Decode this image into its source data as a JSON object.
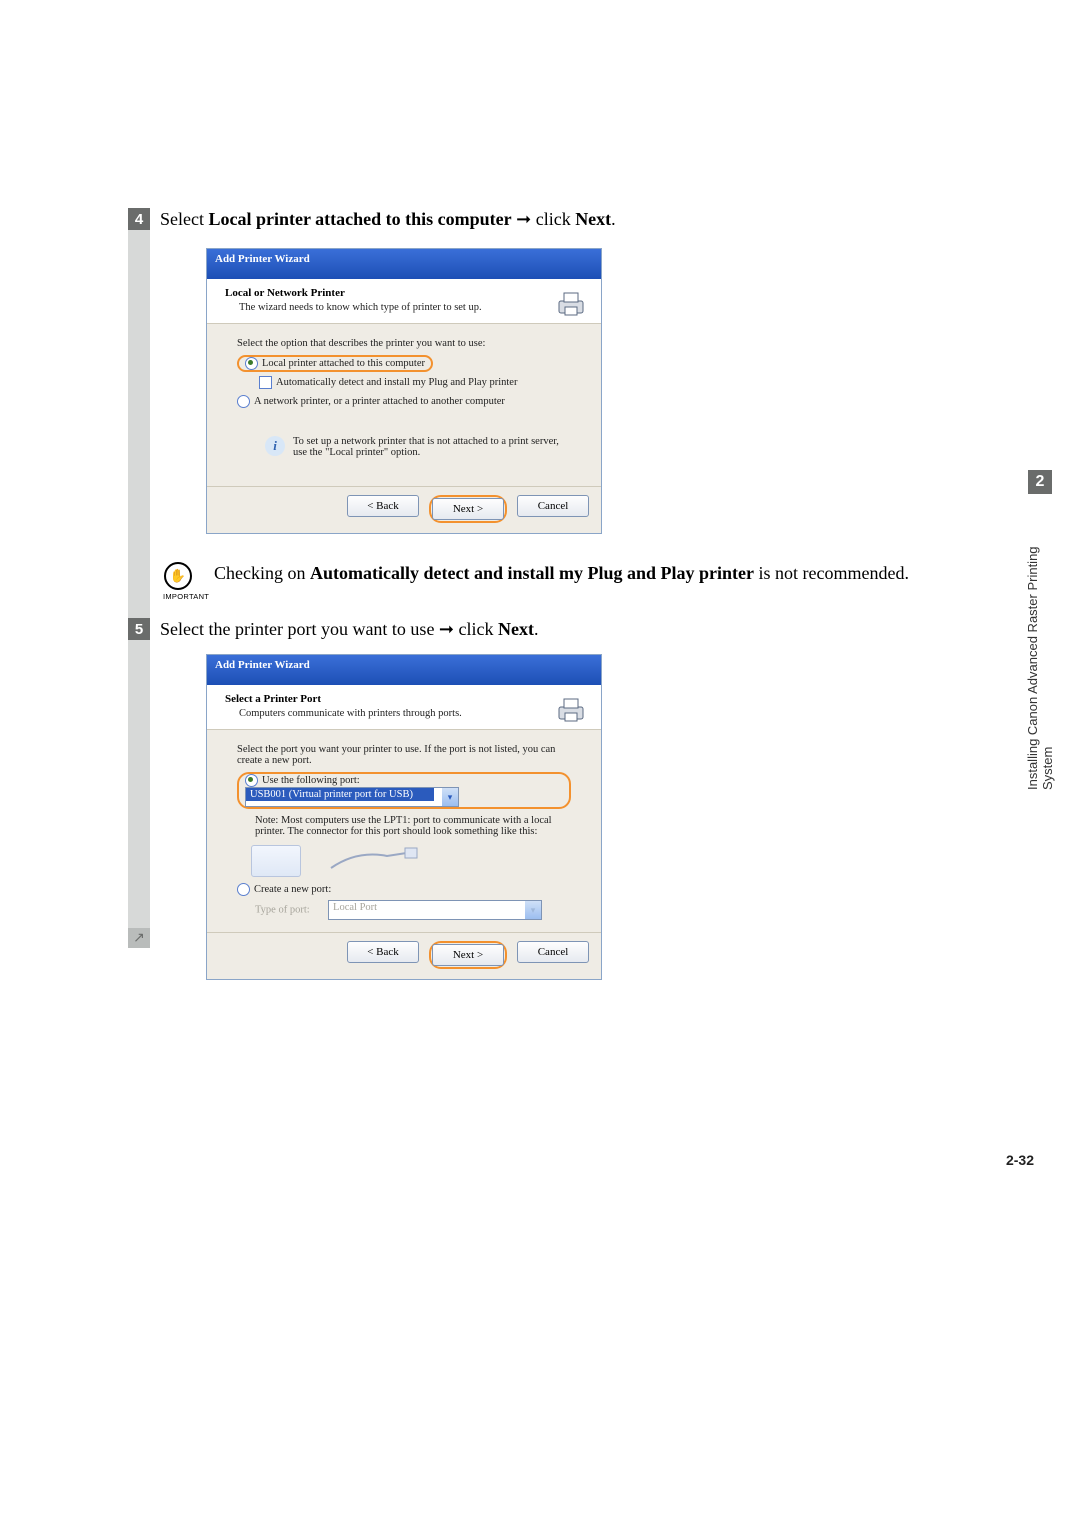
{
  "steps": {
    "s4": {
      "num": "4",
      "text_pre": "Select ",
      "bold1": "Local printer attached to this computer",
      "mid": " ➞ click ",
      "bold2": "Next",
      "tail": "."
    },
    "s5": {
      "num": "5",
      "text_pre": "Select the printer port you want to use ➞ click ",
      "bold": "Next",
      "tail": "."
    }
  },
  "wiz1": {
    "title": "Add Printer Wizard",
    "heading": "Local or Network Printer",
    "subheading": "The wizard needs to know which type of printer to set up.",
    "prompt": "Select the option that describes the printer you want to use:",
    "opt_local": "Local printer attached to this computer",
    "opt_auto": "Automatically detect and install my Plug and Play printer",
    "opt_net": "A network printer, or a printer attached to another computer",
    "info": "To set up a network printer that is not attached to a print server, use the \"Local printer\" option.",
    "back": "< Back",
    "next": "Next >",
    "cancel": "Cancel"
  },
  "important": {
    "label": "IMPORTANT",
    "text_pre": "Checking on ",
    "bold": "Automatically detect and install my Plug and Play printer",
    "text_post": " is not recommended."
  },
  "wiz2": {
    "title": "Add Printer Wizard",
    "heading": "Select a Printer Port",
    "subheading": "Computers communicate with printers through ports.",
    "prompt": "Select the port you want your printer to use.  If the port is not listed, you can create a new port.",
    "opt_use": "Use the following port:",
    "port_value": "USB001 (Virtual printer port for USB)",
    "note": "Note: Most computers use the LPT1: port to communicate with a local printer. The connector for this port should look something like this:",
    "opt_create": "Create a new port:",
    "type_label": "Type of port:",
    "type_value": "Local Port",
    "back": "< Back",
    "next": "Next >",
    "cancel": "Cancel"
  },
  "side": {
    "chapter": "2",
    "title": "Installing Canon Advanced Raster Printing System"
  },
  "page_number": "2-32"
}
